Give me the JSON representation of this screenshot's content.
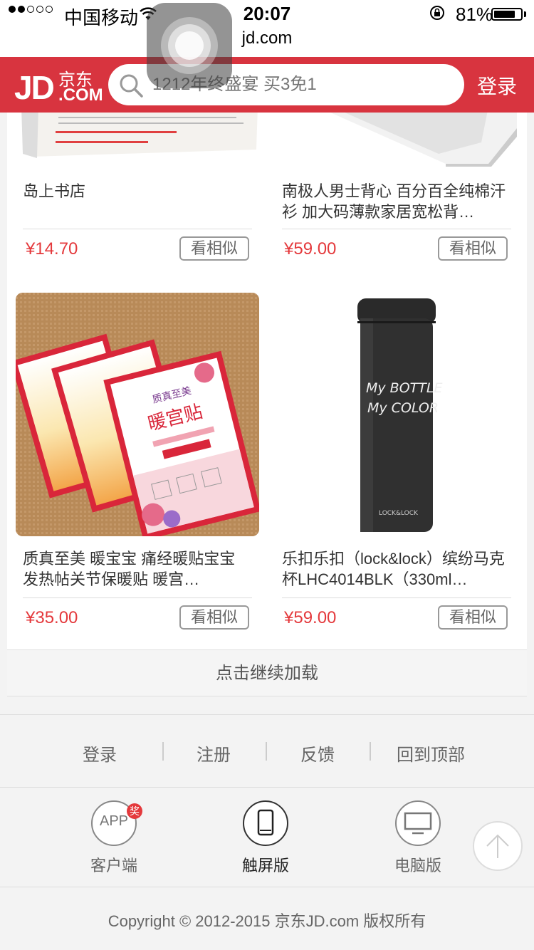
{
  "status_bar": {
    "carrier": "中国移动",
    "time": "20:07",
    "battery": "81%",
    "battery_level": 0.81,
    "signal_bars": 2
  },
  "browser": {
    "url": "jd.com"
  },
  "header": {
    "logo_jd": "JD",
    "logo_cn": "京东",
    "logo_com": ".COM",
    "search_placeholder": "1212年终盛宴 买3免1",
    "login_label": "登录",
    "colors": {
      "brand": "#d8343f"
    }
  },
  "products": [
    {
      "name": "岛上书店",
      "price": "¥14.70",
      "similar_label": "看相似",
      "image": "book-cover"
    },
    {
      "name": "南极人男士背心 百分百全纯棉汗衫 加大码薄款家居宽松背…",
      "price": "¥59.00",
      "similar_label": "看相似",
      "image": "gift-box"
    },
    {
      "name": "质真至美 暖宝宝 痛经暖贴宝宝 发热帖关节保暖贴 暖宫…",
      "price": "¥35.00",
      "similar_label": "看相似",
      "image": "warming-patch"
    },
    {
      "name": "乐扣乐扣（lock&lock）缤纷马克杯LHC4014BLK（330ml…",
      "price": "¥59.00",
      "similar_label": "看相似",
      "image": "black-bottle"
    }
  ],
  "bottle_text": {
    "line1": "My BOTTLE",
    "line2": "My COLOR",
    "brand": "LOCK&LOCK"
  },
  "patch_text": {
    "title": "暖宫贴",
    "brand": "质真至美"
  },
  "load_more": "点击继续加载",
  "footer": {
    "links": [
      "登录",
      "注册",
      "反馈",
      "回到顶部"
    ],
    "versions": [
      {
        "label": "客户端",
        "icon_text": "APP",
        "badge": "奖"
      },
      {
        "label": "触屏版"
      },
      {
        "label": "电脑版"
      }
    ],
    "copyright": "Copyright © 2012-2015 京东JD.com 版权所有"
  }
}
